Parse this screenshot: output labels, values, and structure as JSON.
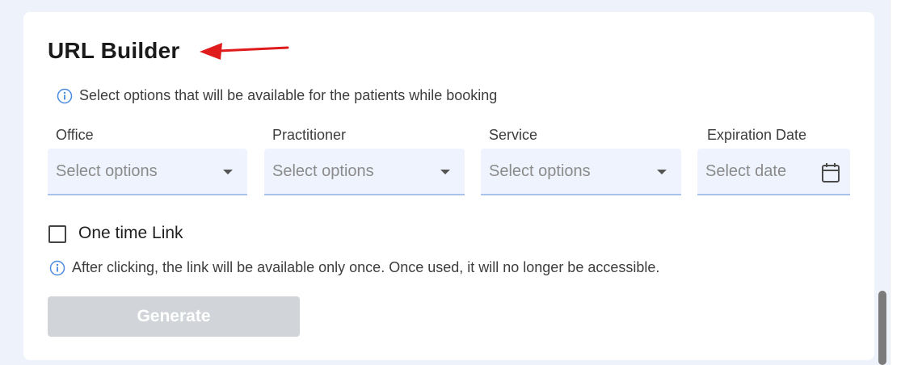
{
  "section": {
    "title": "URL Builder",
    "info_text": "Select options that will be available for the patients while booking"
  },
  "fields": {
    "office": {
      "label": "Office",
      "placeholder": "Select options"
    },
    "practitioner": {
      "label": "Practitioner",
      "placeholder": "Select options"
    },
    "service": {
      "label": "Service",
      "placeholder": "Select options"
    },
    "expiration": {
      "label": "Expiration Date",
      "placeholder": "Select date"
    }
  },
  "one_time": {
    "label": "One time Link",
    "checked": false,
    "info_text": "After clicking, the link will be available only once. Once used, it will no longer be accessible."
  },
  "actions": {
    "generate_label": "Generate",
    "generate_enabled": false
  },
  "colors": {
    "annotation_arrow": "#e01b1b",
    "info_icon": "#4a8be0",
    "select_bg": "#eef3fd",
    "button_disabled": "#d1d4d8"
  },
  "icons": {
    "info": "info-circle-icon",
    "dropdown": "caret-down-icon",
    "date": "calendar-icon",
    "annotation": "red-arrow-icon"
  }
}
